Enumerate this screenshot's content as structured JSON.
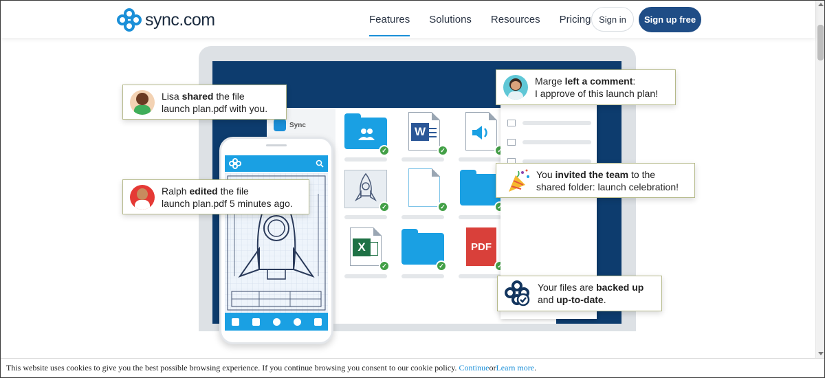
{
  "header": {
    "logo_text_bold": "sync",
    "logo_text_rest": ".com",
    "nav": [
      {
        "label": "Features",
        "active": true
      },
      {
        "label": "Solutions",
        "active": false
      },
      {
        "label": "Resources",
        "active": false
      },
      {
        "label": "Pricing",
        "active": false
      }
    ],
    "signin_label": "Sign in",
    "signup_label": "Sign up free"
  },
  "hero": {
    "app_title": "Sync",
    "pdf_label": "PDF",
    "word_letter": "W",
    "excel_letter": "X",
    "notifications": [
      {
        "pre": "Lisa ",
        "bold": "shared",
        "post": " the file",
        "line2": "launch plan.pdf with you."
      },
      {
        "pre": "Ralph ",
        "bold": "edited",
        "post": " the file",
        "line2": "launch plan.pdf 5 minutes ago."
      },
      {
        "pre": "Marge ",
        "bold": "left a comment",
        "post": ":",
        "line2": "I approve of this launch plan!"
      },
      {
        "pre": "You ",
        "bold": "invited the team",
        "post": " to the",
        "line2": "shared folder: launch celebration!"
      },
      {
        "pre": "Your files are ",
        "bold": "backed up",
        "post": "",
        "line2_pre": "and ",
        "line2_bold": "up-to-date",
        "line2_post": "."
      }
    ]
  },
  "cookie": {
    "text": "This website uses cookies to give you the best possible browsing experience. If you continue browsing you consent to our cookie policy. ",
    "continue_label": "Continue",
    "or": " or ",
    "learn_more_label": "Learn more",
    "end": "."
  },
  "colors": {
    "brand_blue": "#1aa0e3",
    "navy": "#1f4d86",
    "link": "#1a8fd8"
  }
}
